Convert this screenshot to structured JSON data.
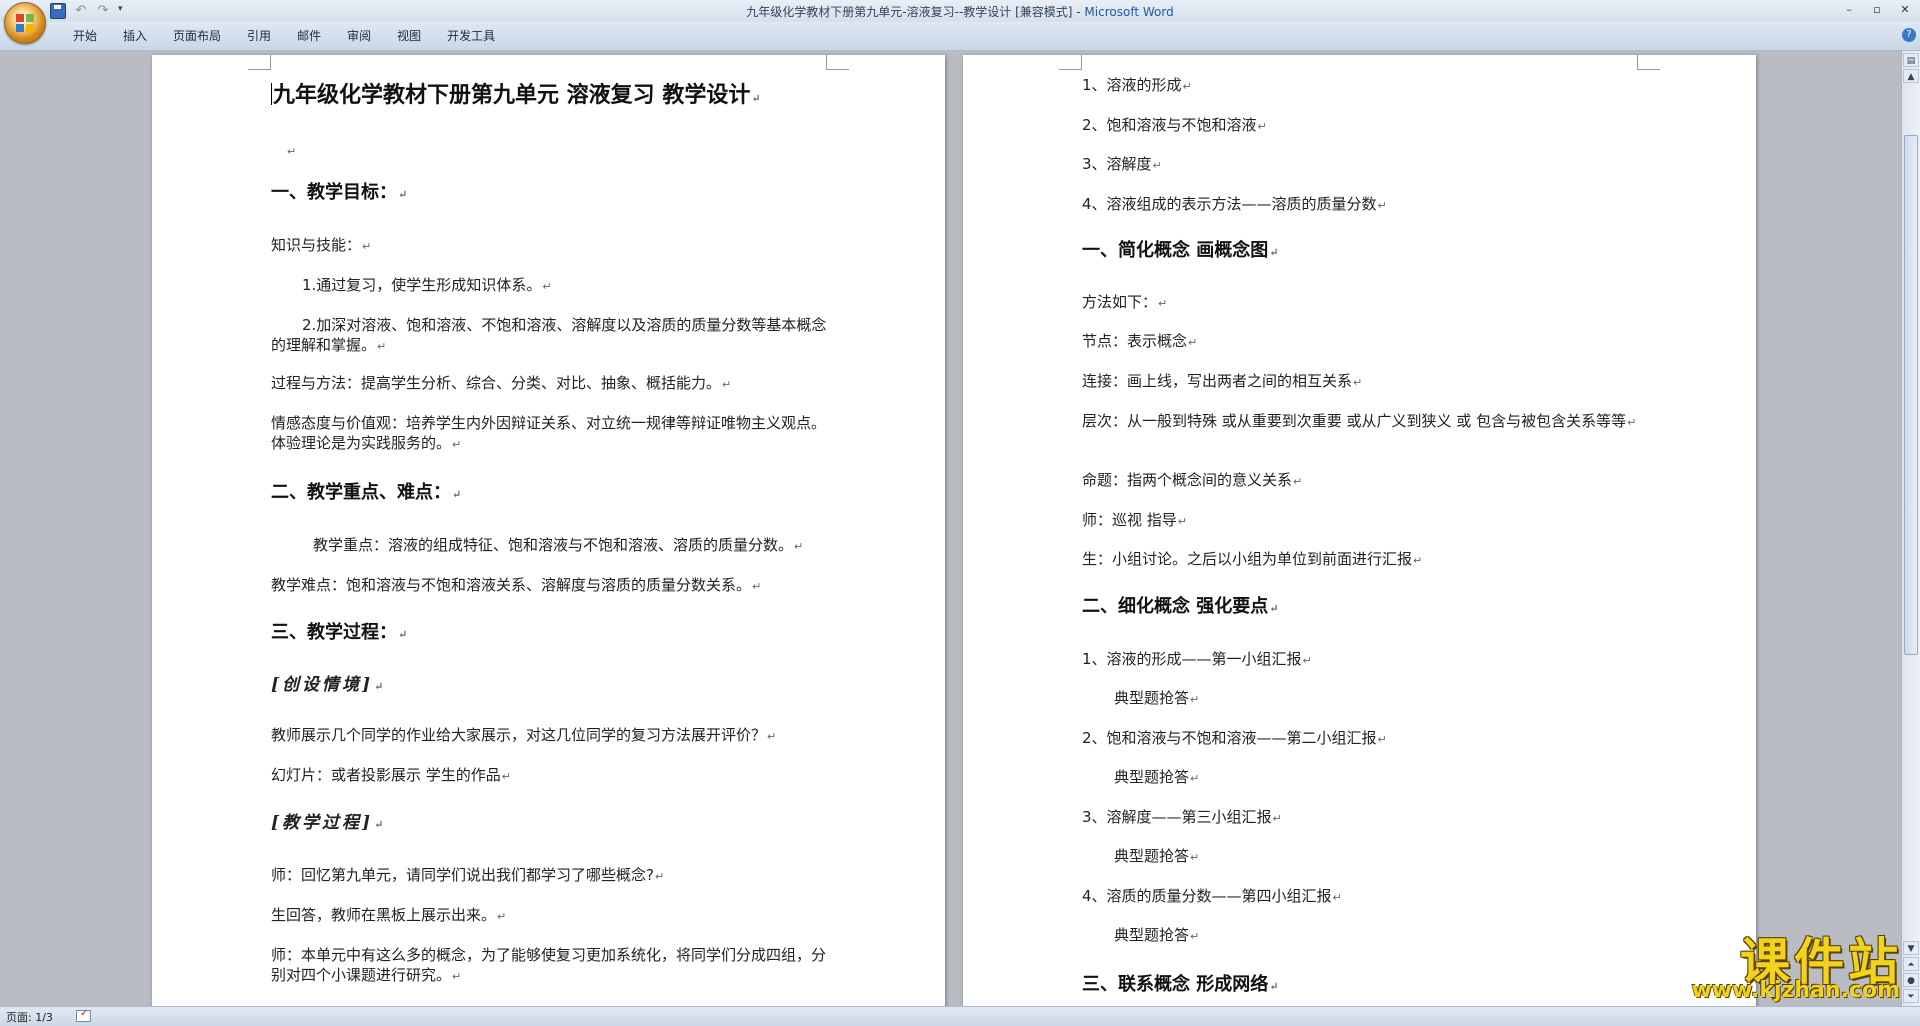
{
  "window": {
    "title": "九年级化学教材下册第九单元-溶液复习--教学设计 [兼容模式] - ",
    "app_name": "Microsoft Word",
    "controls": [
      "–",
      "▫",
      "✕"
    ]
  },
  "ribbon": {
    "tabs": [
      "开始",
      "插入",
      "页面布局",
      "引用",
      "邮件",
      "审阅",
      "视图",
      "开发工具"
    ],
    "help": "?"
  },
  "qat": {
    "undo": "↶",
    "redo": "↷",
    "more": "▾"
  },
  "pilcrow": "↵",
  "page_left": {
    "title": "九年级化学教材下册第九单元 溶液复习   教学设计",
    "h_goals": "一、教学目标：",
    "knowledge": "知识与技能：",
    "k1": "1.通过复习，使学生形成知识体系。",
    "k2": "2.加深对溶液、饱和溶液、不饱和溶液、溶解度以及溶质的质量分数等基本概念的理解和掌握。",
    "process_method": "过程与方法：提高学生分析、综合、分类、对比、抽象、概括能力。",
    "emotion": "情感态度与价值观：培养学生内外因辩证关系、对立统一规律等辩证唯物主义观点。体验理论是为实践服务的。",
    "h_key": "二、教学重点、难点：",
    "key_point": "教学重点：溶液的组成特征、饱和溶液与不饱和溶液、溶质的质量分数。",
    "difficulty": "教学难点：饱和溶液与不饱和溶液关系、溶解度与溶质的质量分数关系。",
    "h_process": "三、教学过程：",
    "scene": "[创设情境]",
    "teacher_show": "教师展示几个同学的作业给大家展示，对这几位同学的复习方法展开评价？",
    "slides": "幻灯片：或者投影展示 学生的作品",
    "teach_process": "[教学过程]",
    "teacher_recall": "师：回忆第九单元，请同学们说出我们都学习了哪些概念?",
    "student_answer": "生回答，教师在黑板上展示出来。",
    "teacher_group": "师：本单元中有这么多的概念，为了能够使复习更加系统化，将同学们分成四组，分别对四个小课题进行研究。"
  },
  "page_right": {
    "item1": "1、溶液的形成",
    "item2": "2、饱和溶液与不饱和溶液",
    "item3": "3、溶解度",
    "item4": "4、溶液组成的表示方法——溶质的质量分数",
    "h_simplify": "一、简化概念 画概念图",
    "method": "方法如下：",
    "node": "节点：表示概念",
    "link": "连接：画上线，写出两者之间的相互关系",
    "level": "层次：从一般到特殊   或从重要到次重要   或从广义到狭义  或 包含与被包含关系等等",
    "proposition": "命题：指两个概念间的意义关系",
    "teacher_guide": "师：巡视 指导",
    "student_discuss": "生：小组讨论。之后以小组为单位到前面进行汇报",
    "h_refine": "二、细化概念    强化要点",
    "report1": "1、溶液的形成——第一小组汇报",
    "answer1": "典型题抢答",
    "report2": "2、饱和溶液与不饱和溶液——第二小组汇报",
    "answer2": "典型题抢答",
    "report3": "3、溶解度——第三小组汇报",
    "answer3": "典型题抢答",
    "report4": "4、溶质的质量分数——第四小组汇报",
    "answer4": "典型题抢答",
    "h_connect": "三、联系概念    形成网络"
  },
  "statusbar": {
    "page": "页面: 1/3"
  },
  "watermark": {
    "title": "课件站",
    "url": "www.kjzhan.com"
  },
  "colors": {
    "ribbon": "#dfe8f3",
    "workspace": "#b9bdc3",
    "watermark": "#f2d21a"
  }
}
